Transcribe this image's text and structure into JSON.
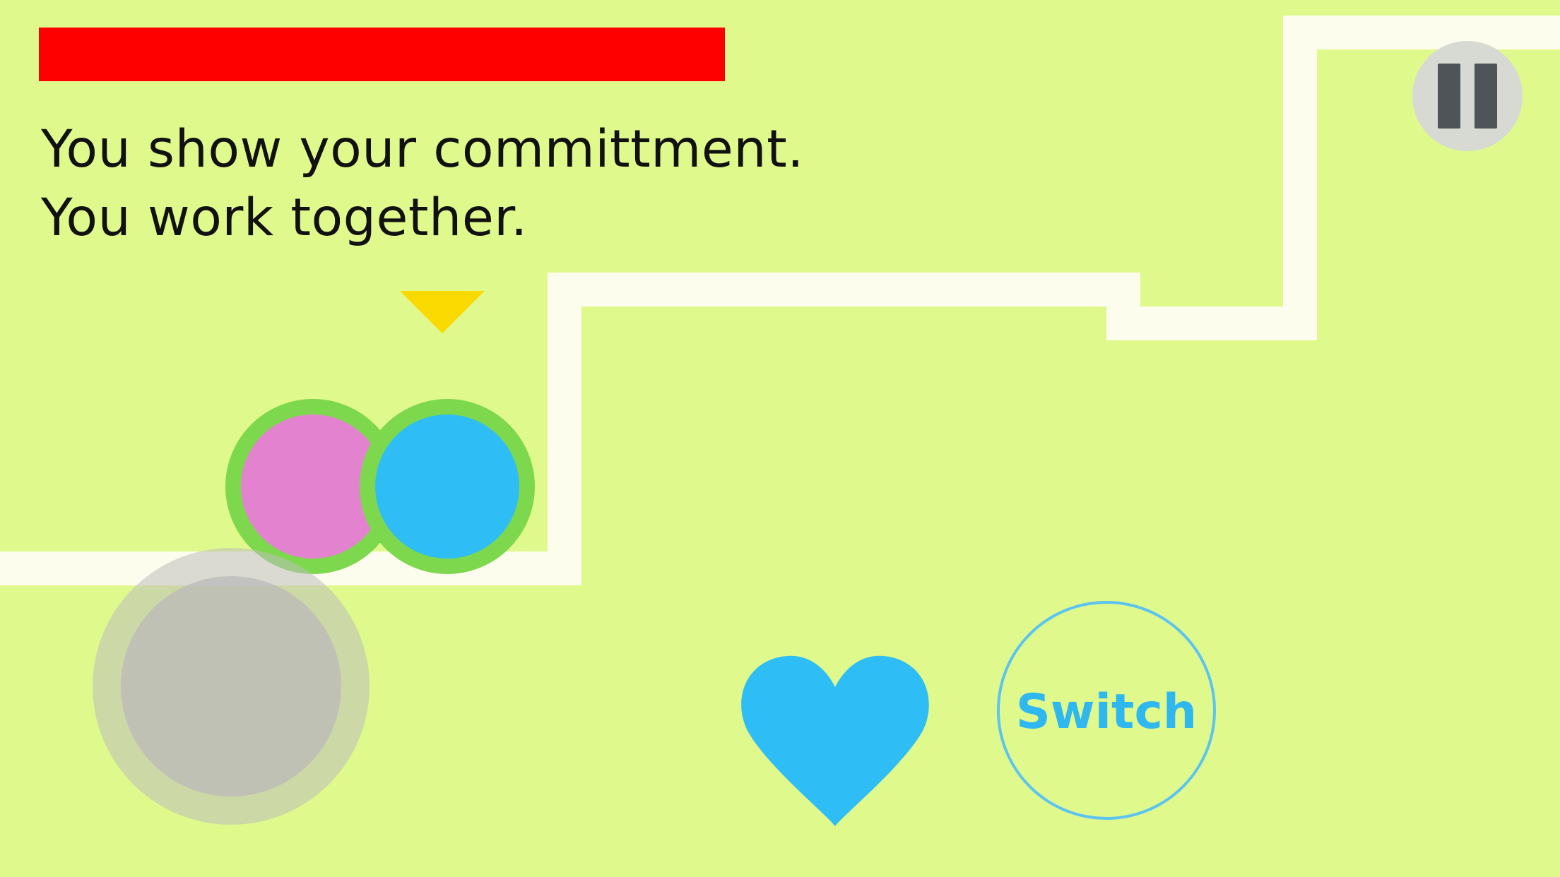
{
  "hud": {
    "health": {
      "value": 1.0,
      "color": "#ff0000"
    },
    "pause_icon": "pause-icon"
  },
  "story": {
    "line1": "You show your committment.",
    "line2": "You work together."
  },
  "characters": {
    "pink": {
      "color": "#e383cf",
      "outline": "#7ed84d"
    },
    "blue": {
      "color": "#2fbdf5",
      "outline": "#7ed84d"
    },
    "indicator_color": "#fada00",
    "active": "blue"
  },
  "controls": {
    "switch_label": "Switch",
    "heart_icon": "heart-icon",
    "heart_color": "#2fbdf5",
    "accent_color": "#2fb8f0"
  },
  "colors": {
    "background": "#e0f98c",
    "path": "#fdfded"
  }
}
